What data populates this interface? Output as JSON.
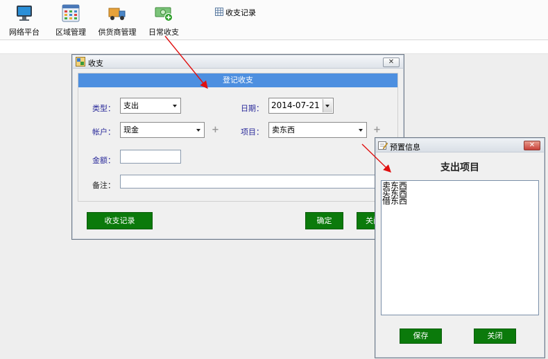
{
  "toolbar": {
    "items": [
      {
        "label": "网络平台",
        "icon": "network-platform-icon"
      },
      {
        "label": "区域管理",
        "icon": "region-grid-icon"
      },
      {
        "label": "供货商管理",
        "icon": "supplier-truck-icon"
      },
      {
        "label": "日常收支",
        "icon": "daily-cash-icon"
      }
    ],
    "link_label": "收支记录"
  },
  "main_dialog": {
    "title": "收支",
    "panel_title": "登记收支",
    "type_label": "类型：",
    "type_value": "支出",
    "date_label": "日期：",
    "date_value": "2014-07-21",
    "account_label": "帐户：",
    "account_value": "现金",
    "item_label": "项目：",
    "item_value": "卖东西",
    "amount_label": "金额：",
    "amount_value": "",
    "note_label": "备注：",
    "note_value": "",
    "records_button": "收支记录",
    "confirm_button": "确定",
    "close_button_partial": "关闭"
  },
  "preset_dialog": {
    "title": "预置信息",
    "heading": "支出项目",
    "items": [
      "卖东西",
      "买东西",
      "借东西"
    ],
    "save_button": "保存",
    "close_button": "关闭"
  },
  "colors": {
    "panel_header": "#4d8fe0",
    "button_green": "#0b7a0b",
    "label_blue": "#2a2a9a",
    "arrow_red": "#e01010"
  }
}
